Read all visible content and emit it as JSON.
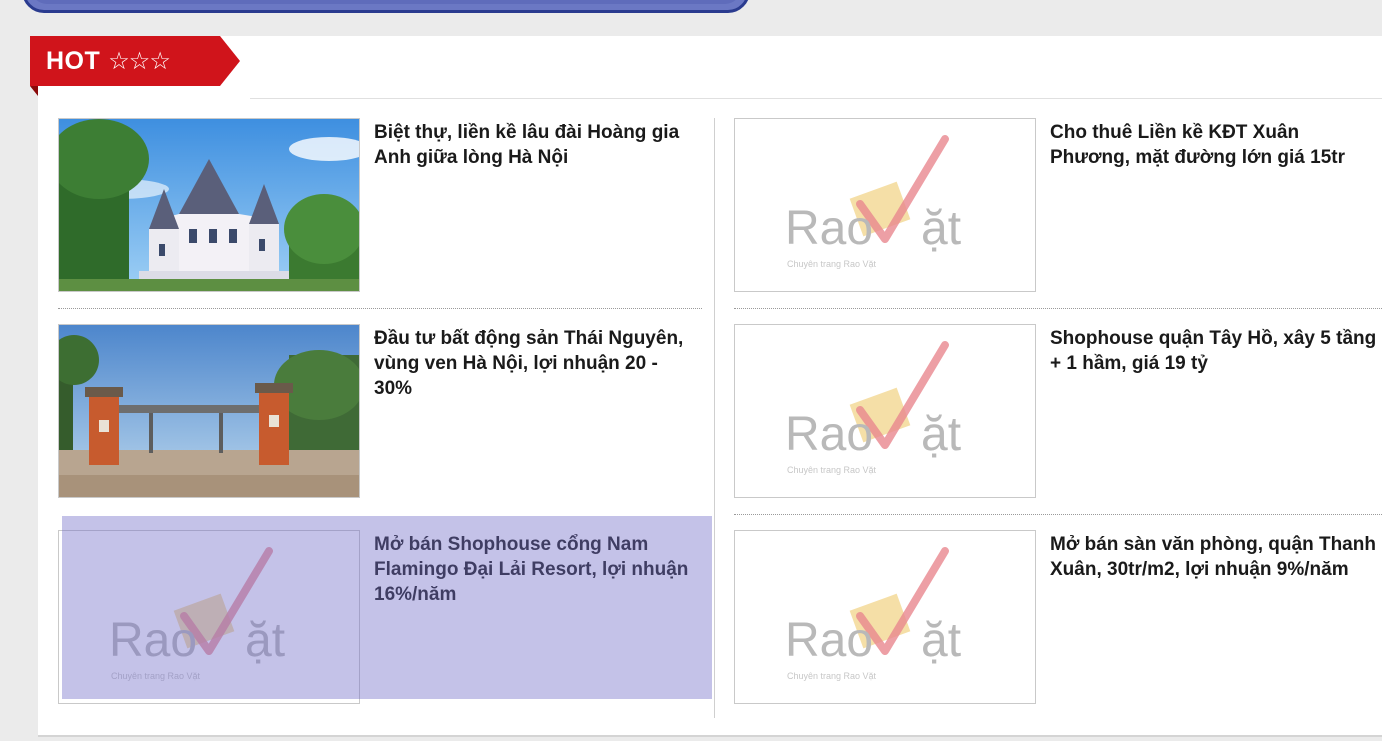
{
  "header": {
    "hot_label": "HOT",
    "stars": "☆☆☆"
  },
  "listings": [
    {
      "title": "Biệt thự, liền kề lâu đài Hoàng gia Anh giữa lòng Hà Nội",
      "thumb": "castle-villa-photo"
    },
    {
      "title": "Cho thuê Liền kề KĐT Xuân Phương, mặt đường lớn giá 15tr",
      "thumb": "raovat-placeholder"
    },
    {
      "title": "Đầu tư bất động sản Thái Nguyên, vùng ven Hà Nội, lợi nhuận 20 - 30%",
      "thumb": "gate-project-photo"
    },
    {
      "title": "Shophouse quận Tây Hồ, xây 5 tầng + 1 hầm, giá 19 tỷ",
      "thumb": "raovat-placeholder"
    },
    {
      "title": "Mở bán Shophouse cổng Nam Flamingo Đại Lải Resort, lợi nhuận 16%/năm",
      "thumb": "raovat-placeholder"
    },
    {
      "title": "Mở bán sàn văn phòng, quận Thanh Xuân, 30tr/m2, lợi nhuận 9%/năm",
      "thumb": "raovat-placeholder"
    }
  ],
  "placeholder_logo": {
    "word_left": "Rao",
    "word_right": "ặt",
    "tagline": "Chuyên trang Rao Vặt"
  },
  "colors": {
    "hot_red": "#d0141b",
    "check_pink": "#e8878f",
    "logo_gray": "#b9b9b9",
    "selection": "#736ec8"
  }
}
